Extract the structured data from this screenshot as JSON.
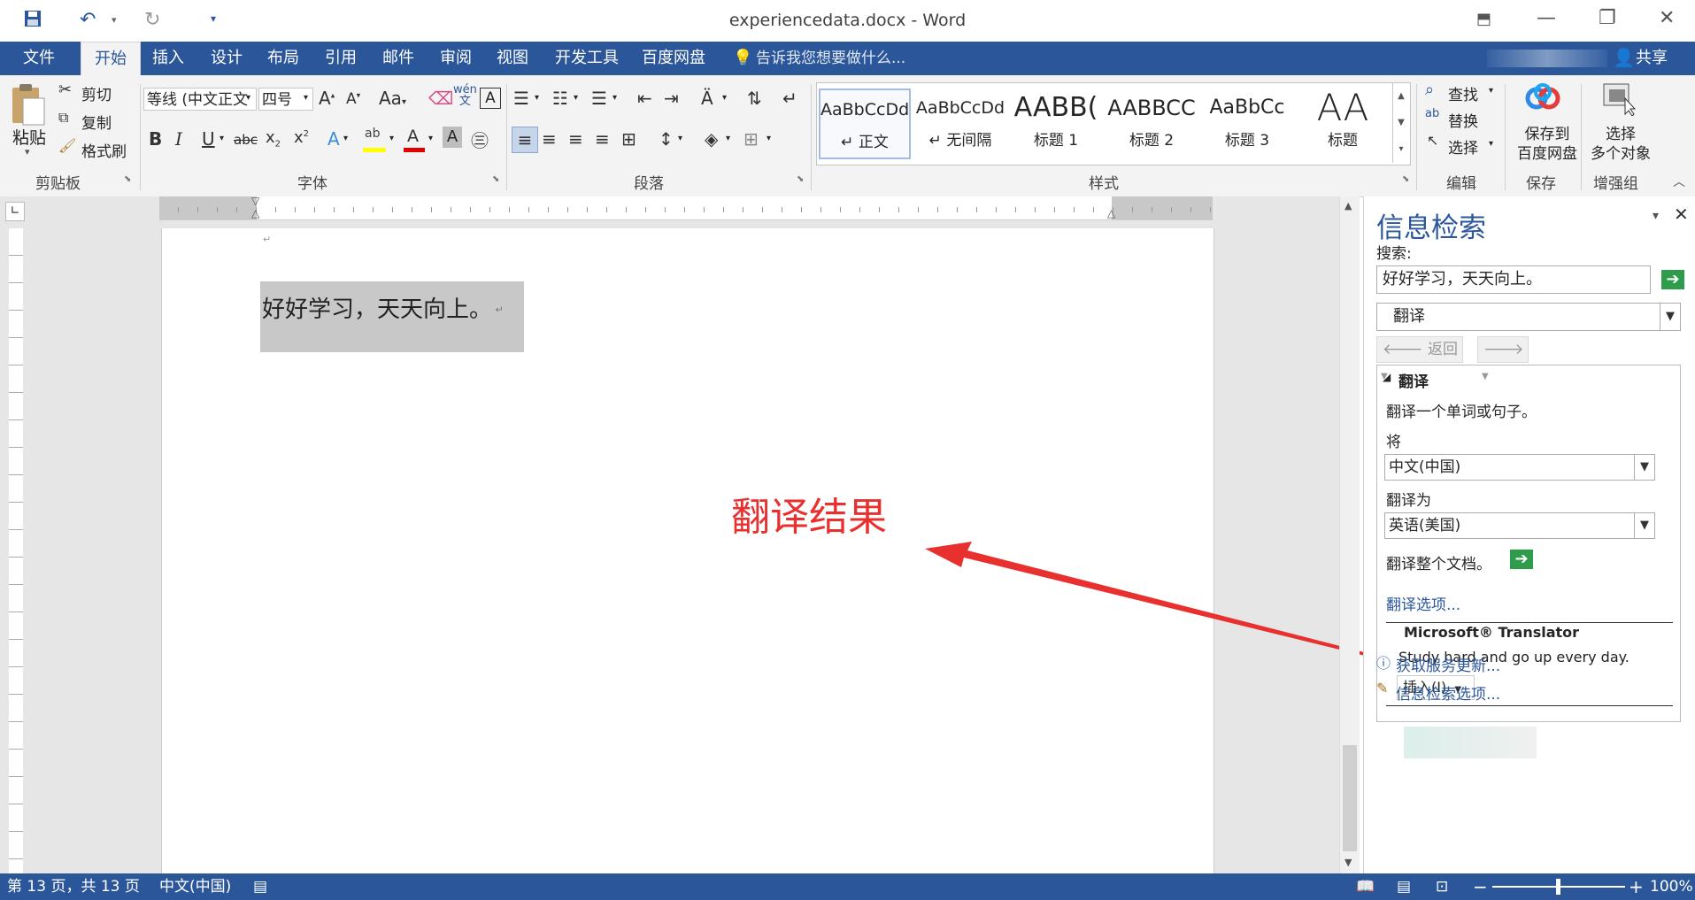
{
  "window": {
    "title": "experiencedata.docx - Word"
  },
  "tabs": [
    {
      "label": "文件"
    },
    {
      "label": "开始"
    },
    {
      "label": "插入"
    },
    {
      "label": "设计"
    },
    {
      "label": "布局"
    },
    {
      "label": "引用"
    },
    {
      "label": "邮件"
    },
    {
      "label": "审阅"
    },
    {
      "label": "视图"
    },
    {
      "label": "开发工具"
    },
    {
      "label": "百度网盘"
    }
  ],
  "tell_me": "告诉我您想要做什么...",
  "share": "共享",
  "clipboard": {
    "paste": "粘贴",
    "cut": "剪切",
    "copy": "复制",
    "format_painter": "格式刷",
    "label": "剪贴板"
  },
  "font": {
    "name": "等线 (中文正文",
    "size": "四号",
    "change_case": "Aa",
    "label": "字体"
  },
  "paragraph": {
    "label": "段落"
  },
  "styles": {
    "label": "样式",
    "items": [
      {
        "sample": "AaBbCcDd",
        "name": "↵ 正文"
      },
      {
        "sample": "AaBbCcDd",
        "name": "↵ 无间隔"
      },
      {
        "sample": "AABB(",
        "name": "标题 1"
      },
      {
        "sample": "AABBCC",
        "name": "标题 2"
      },
      {
        "sample": "AaBbCc",
        "name": "标题 3"
      },
      {
        "sample": "AA",
        "name": "标题"
      }
    ]
  },
  "editing": {
    "find": "查找",
    "replace": "替换",
    "select": "选择",
    "label": "编辑"
  },
  "save_group": {
    "button": "保存到百度网盘",
    "line1": "保存到",
    "line2": "百度网盘",
    "label": "保存"
  },
  "enhance": {
    "line1": "选择",
    "line2": "多个对象",
    "label": "增强组"
  },
  "document": {
    "text": "好好学习，天天向上。",
    "annotation": "翻译结果"
  },
  "pane": {
    "title": "信息检索",
    "search_label": "搜索:",
    "search_value": "好好学习，天天向上。",
    "service": "翻译",
    "back": "返回",
    "section_title": "翻译",
    "section_desc": "翻译一个单词或句子。",
    "from_label": "将",
    "from_value": "中文(中国)",
    "to_label": "翻译为",
    "to_value": "英语(美国)",
    "translate_doc": "翻译整个文档。",
    "options_link": "翻译选项...",
    "provider": "Microsoft® Translator",
    "result": "Study hard and go up every day.",
    "insert": "插入(I)",
    "get_updates": "获取服务更新...",
    "research_options": "信息检索选项..."
  },
  "status": {
    "page": "第 13 页，共 13 页",
    "language": "中文(中国)",
    "zoom": "100%"
  },
  "colors": {
    "brand": "#2b579a",
    "accent_red": "#e8302f",
    "highlight_yellow": "#ffff00",
    "font_red": "#e00000"
  }
}
